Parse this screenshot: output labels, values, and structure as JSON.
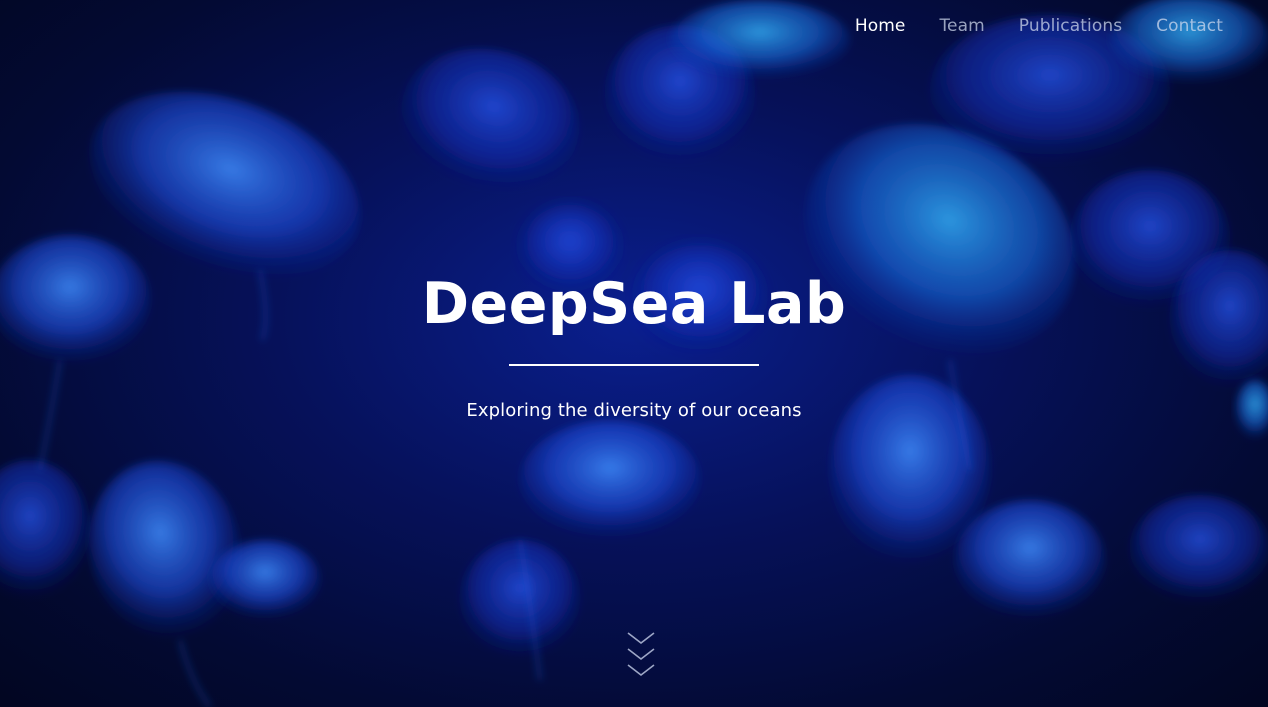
{
  "nav": {
    "items": [
      {
        "label": "Home",
        "active": true
      },
      {
        "label": "Team",
        "active": false
      },
      {
        "label": "Publications",
        "active": false
      },
      {
        "label": "Contact",
        "active": false
      }
    ]
  },
  "hero": {
    "title": "DeepSea Lab",
    "subtitle": "Exploring the diversity of our oceans",
    "background_image": "jellyfish-underwater",
    "scroll_icon": "triple-chevron-down-icon"
  },
  "colors": {
    "background_dark": "#020621",
    "background_blue": "#0a1f8f",
    "jellyfish_glow": "#2f7bff",
    "text": "#ffffff",
    "nav_inactive": "#c8d3ea"
  }
}
